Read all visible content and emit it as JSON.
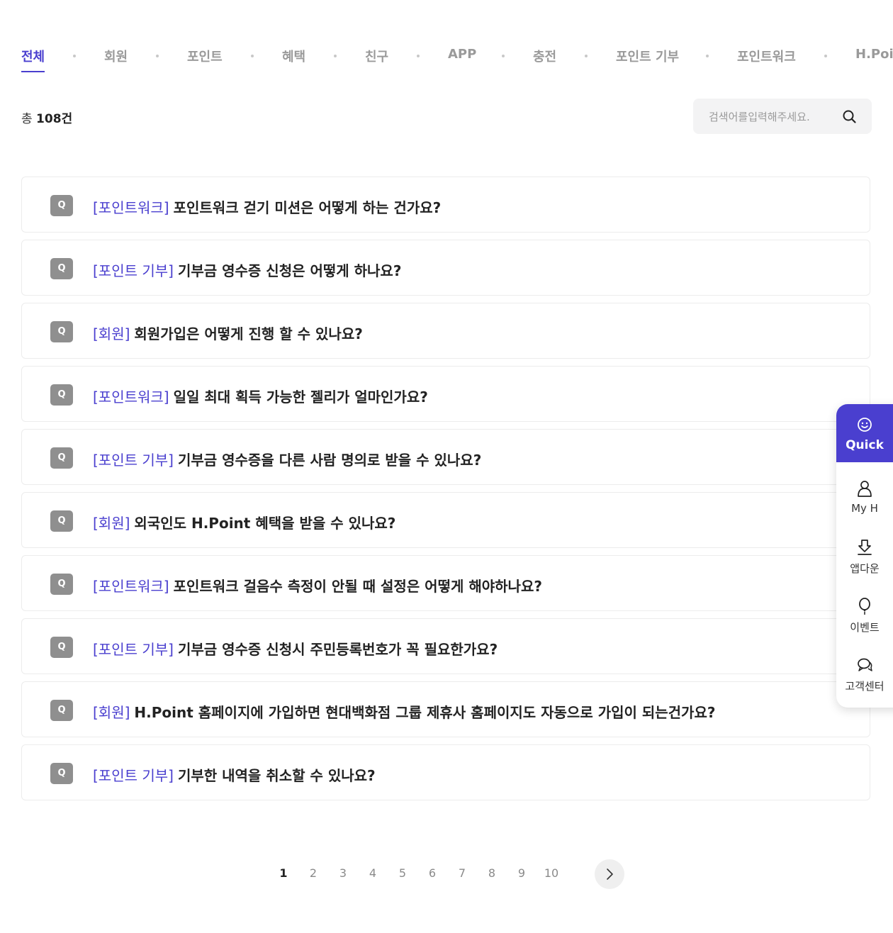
{
  "tabs": [
    {
      "label": "전체",
      "active": true
    },
    {
      "label": "회원"
    },
    {
      "label": "포인트"
    },
    {
      "label": "혜택"
    },
    {
      "label": "친구"
    },
    {
      "label": "APP"
    },
    {
      "label": "충전"
    },
    {
      "label": "포인트 기부"
    },
    {
      "label": "포인트워크"
    },
    {
      "label": "H.Point"
    }
  ],
  "total": {
    "prefix": "총",
    "count": "108건"
  },
  "search": {
    "placeholder": "검색어를입력해주세요.",
    "icon": "search-icon"
  },
  "faq": {
    "badge": "Q",
    "items": [
      {
        "category": "[포인트워크]",
        "question": "포인트워크 걷기 미션은 어떻게 하는 건가요?"
      },
      {
        "category": "[포인트 기부]",
        "question": "기부금 영수증 신청은 어떻게 하나요?"
      },
      {
        "category": "[회원]",
        "question": "회원가입은 어떻게 진행 할 수 있나요?"
      },
      {
        "category": "[포인트워크]",
        "question": "일일 최대 획득 가능한 젤리가 얼마인가요?"
      },
      {
        "category": "[포인트 기부]",
        "question": "기부금 영수증을 다른 사람 명의로 받을 수 있나요?"
      },
      {
        "category": "[회원]",
        "question": "외국인도 H.Point 혜택을 받을 수 있나요?"
      },
      {
        "category": "[포인트워크]",
        "question": "포인트워크 걸음수 측정이 안될 때 설정은 어떻게 해야하나요?"
      },
      {
        "category": "[포인트 기부]",
        "question": "기부금 영수증 신청시 주민등록번호가 꼭 필요한가요?"
      },
      {
        "category": "[회원]",
        "question": "H.Point 홈페이지에 가입하면 현대백화점 그룹 제휴사 홈페이지도 자동으로 가입이 되는건가요?"
      },
      {
        "category": "[포인트 기부]",
        "question": "기부한 내역을 취소할 수 있나요?"
      }
    ]
  },
  "pagination": {
    "pages": [
      "1",
      "2",
      "3",
      "4",
      "5",
      "6",
      "7",
      "8",
      "9",
      "10"
    ],
    "current": "1",
    "next_icon": "chevron-right-icon"
  },
  "quick": {
    "title": "Quick",
    "items": [
      {
        "label": "My H",
        "icon": "user-icon"
      },
      {
        "label": "앱다운",
        "icon": "download-icon"
      },
      {
        "label": "이벤트",
        "icon": "balloon-icon"
      },
      {
        "label": "고객센터",
        "icon": "chat-icon"
      }
    ]
  },
  "colors": {
    "accent": "#4a3fcf",
    "badge": "#8f8f8f",
    "muted": "#9a9a9a"
  }
}
